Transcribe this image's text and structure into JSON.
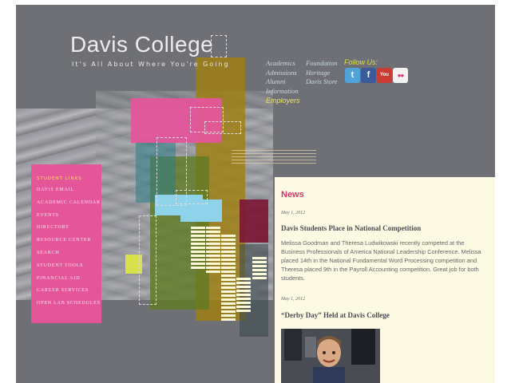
{
  "brand": {
    "title": "Davis College",
    "tagline": "It's All About Where You're Going"
  },
  "nav": {
    "col1": [
      "Academics",
      "Admissions",
      "Alumni",
      "Information"
    ],
    "col2": [
      "Foundation",
      "Heritage",
      "Davis Store"
    ],
    "employers": "Employers"
  },
  "social": {
    "follow_label": "Follow Us:",
    "items": [
      {
        "name": "twitter",
        "glyph": "t",
        "color": "#4fa3d9"
      },
      {
        "name": "facebook",
        "glyph": "f",
        "color": "#3b5a9a"
      },
      {
        "name": "youtube",
        "glyph": "You",
        "color": "#c93b33"
      },
      {
        "name": "flickr",
        "glyph": "●●",
        "color": "#f2f2f2"
      }
    ]
  },
  "student_links": {
    "heading": "STUDENT LINKS",
    "items": [
      "Davis Email",
      "Academic Calendar",
      "Events",
      "Directory",
      "Resource Center",
      "Search",
      "Student Tools",
      "Financial Aid",
      "Career Services",
      "Open Lab Schedules"
    ]
  },
  "news": {
    "title": "News",
    "items": [
      {
        "date": "May 1, 2012",
        "headline": "Davis Students Place in National Competition",
        "body": "Melissa Goodman and Theresa Ludwikowski recently competed at the Business Professionals of America National Leadership Conference. Melissa placed 14th in the National Fundamental Word Processing competition and Theresa placed 9th in the Payroll Accounting competition. Great job for both students."
      },
      {
        "date": "May 1, 2012",
        "headline": "“Derby Day” Held at Davis College",
        "body": ""
      }
    ]
  },
  "colors": {
    "background": "#6f7075",
    "pink": "#e4559a",
    "gold": "#a07f10",
    "olive": "#6f8a2a",
    "cyan": "#8fd3ea",
    "maroon": "#7a1433",
    "lime": "#d8e04a",
    "news_bg": "#fdfae4",
    "news_title": "#d6326e"
  }
}
